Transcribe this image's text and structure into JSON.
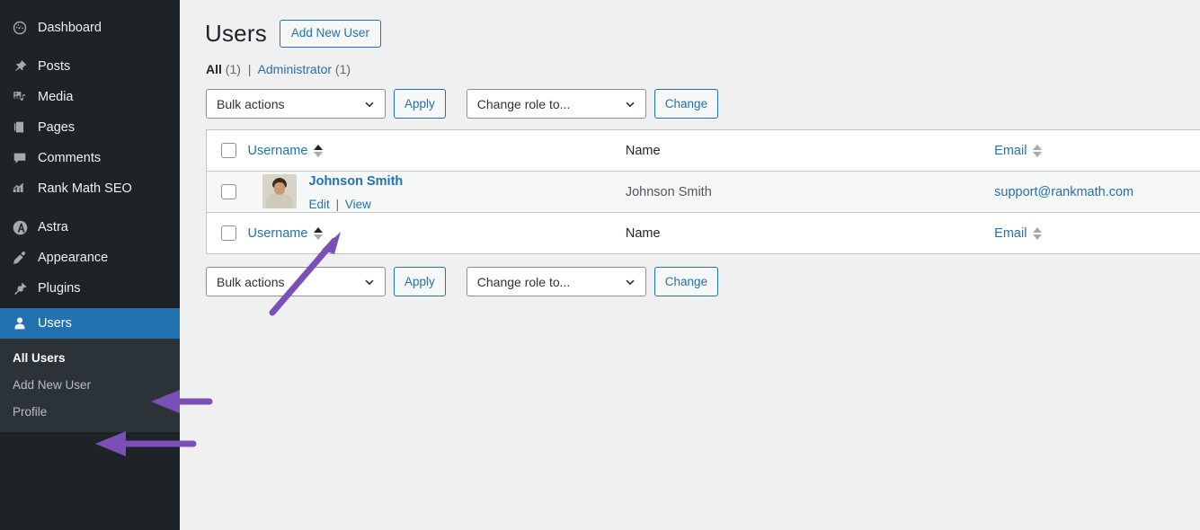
{
  "sidebar": {
    "items": [
      {
        "label": "Dashboard",
        "icon": "dashboard-icon",
        "active": false
      },
      {
        "label": "Posts",
        "icon": "pin-icon",
        "active": false
      },
      {
        "label": "Media",
        "icon": "media-icon",
        "active": false
      },
      {
        "label": "Pages",
        "icon": "pages-icon",
        "active": false
      },
      {
        "label": "Comments",
        "icon": "comments-icon",
        "active": false
      },
      {
        "label": "Rank Math SEO",
        "icon": "rank-math-icon",
        "active": false
      },
      {
        "label": "Astra",
        "icon": "astra-icon",
        "active": false
      },
      {
        "label": "Appearance",
        "icon": "appearance-icon",
        "active": false
      },
      {
        "label": "Plugins",
        "icon": "plugin-icon",
        "active": false
      },
      {
        "label": "Users",
        "icon": "users-icon",
        "active": true
      }
    ],
    "submenu": [
      {
        "label": "All Users",
        "current": true
      },
      {
        "label": "Add New User",
        "current": false
      },
      {
        "label": "Profile",
        "current": false
      }
    ]
  },
  "header": {
    "title": "Users",
    "add_new_button": "Add New User"
  },
  "filters": {
    "all_label": "All",
    "all_count": "(1)",
    "separator": "|",
    "administrator_label": "Administrator",
    "administrator_count": "(1)"
  },
  "toolbar": {
    "bulk_actions_value": "Bulk actions",
    "apply_label": "Apply",
    "change_role_value": "Change role to...",
    "change_label": "Change"
  },
  "table": {
    "columns": {
      "username": "Username",
      "name": "Name",
      "email": "Email"
    },
    "rows": [
      {
        "username": "Johnson Smith",
        "edit_label": "Edit",
        "action_separator": "|",
        "view_label": "View",
        "name": "Johnson Smith",
        "email": "support@rankmath.com"
      }
    ]
  },
  "colors": {
    "sidebar_bg": "#1d2327",
    "submenu_bg": "#2c3338",
    "active_blue": "#2271b1",
    "link_blue": "#2271b1",
    "annotation_purple": "#7b4fb8",
    "page_bg": "#f0f0f1",
    "row_stripe": "#f6f7f7"
  },
  "annotations": [
    {
      "name": "arrow-to-users-menu",
      "direction": "left"
    },
    {
      "name": "arrow-to-all-users-submenu",
      "direction": "left"
    },
    {
      "name": "arrow-to-edit-link",
      "direction": "up-right"
    }
  ]
}
